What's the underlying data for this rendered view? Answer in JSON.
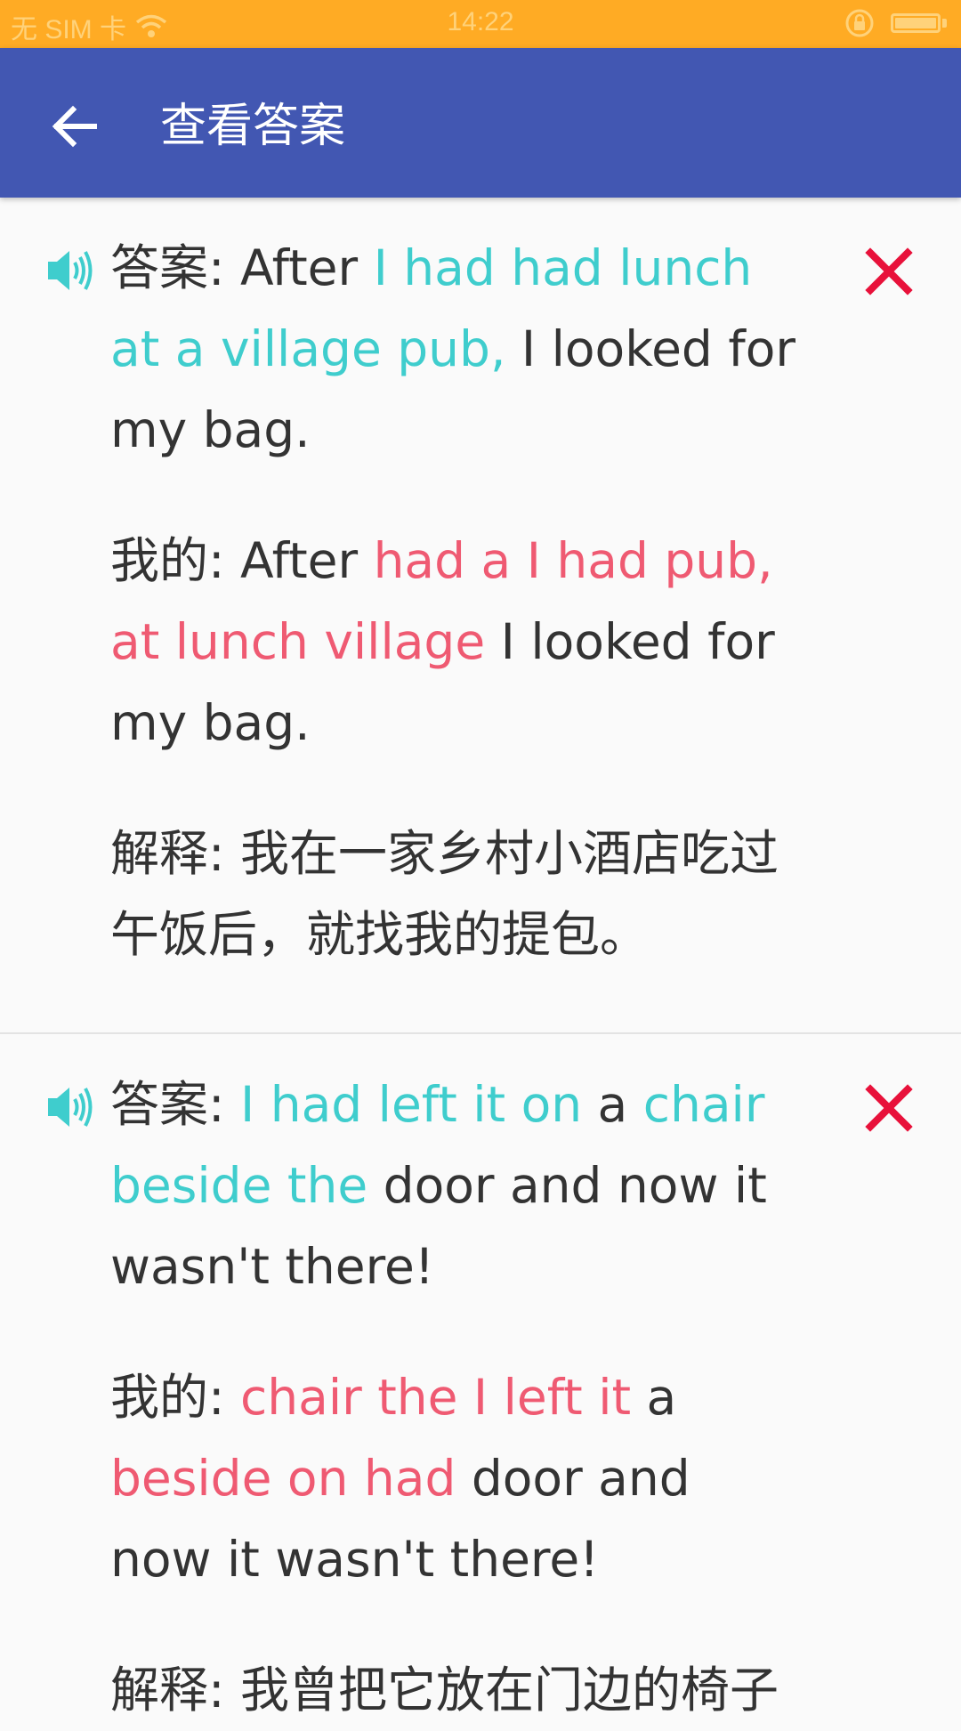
{
  "status_bar": {
    "carrier": "无 SIM 卡",
    "time": "14:22",
    "icons": [
      "wifi-icon",
      "rotation-lock-icon",
      "battery-icon"
    ]
  },
  "toolbar": {
    "title": "查看答案",
    "back_icon": "arrow-left-icon"
  },
  "colors": {
    "status_bar": "#ffab24",
    "app_bar": "#4257b2",
    "correct_text": "#3fcdcd",
    "wrong_text": "#ef5a72",
    "wrong_mark": "#e8113a",
    "speaker": "#3fcdcd"
  },
  "questions": [
    {
      "answer_label": "答案: ",
      "answer_parts": [
        {
          "text": "After ",
          "style": "normal"
        },
        {
          "text": "I had had lunch at a village pub,",
          "style": "correct"
        },
        {
          "text": " I looked for my bag.",
          "style": "normal"
        }
      ],
      "mine_label": "我的: ",
      "mine_parts": [
        {
          "text": "After ",
          "style": "normal"
        },
        {
          "text": "had a I had pub, at lunch village",
          "style": "wrong"
        },
        {
          "text": " I looked for my bag.",
          "style": "normal"
        }
      ],
      "explain_label": "解释: ",
      "explain_text": "我在一家乡村小酒店吃过午饭后，就找我的提包。",
      "result_icon": "cross-icon"
    },
    {
      "answer_label": "答案: ",
      "answer_parts": [
        {
          "text": "I had left it on",
          "style": "correct"
        },
        {
          "text": " a ",
          "style": "normal"
        },
        {
          "text": "chair beside the",
          "style": "correct"
        },
        {
          "text": " door and now it wasn't there!",
          "style": "normal"
        }
      ],
      "mine_label": "我的: ",
      "mine_parts": [
        {
          "text": "chair the I left it",
          "style": "wrong"
        },
        {
          "text": " a ",
          "style": "normal"
        },
        {
          "text": "beside on had",
          "style": "wrong"
        },
        {
          "text": " door and now it wasn't there!",
          "style": "normal"
        }
      ],
      "explain_label": "解释: ",
      "explain_text": "我曾把它放在门边的椅子",
      "result_icon": "cross-icon"
    }
  ]
}
